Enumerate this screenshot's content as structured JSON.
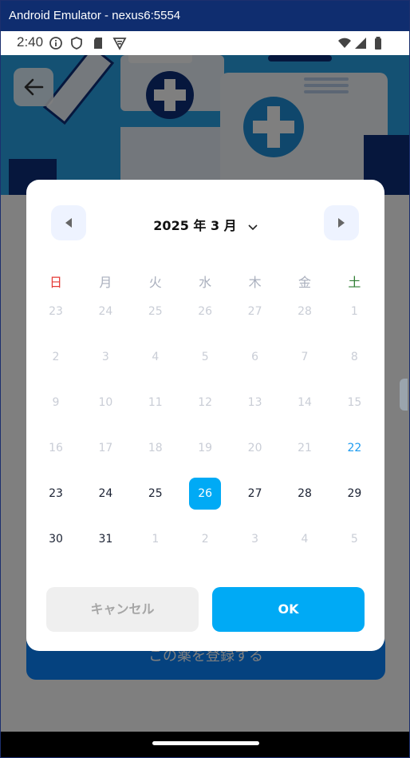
{
  "window": {
    "title": "Android Emulator - nexus6:5554"
  },
  "statusbar": {
    "time": "2:40",
    "icons": [
      "info-icon",
      "shield-icon",
      "sd-card-icon",
      "vpn-icon",
      "wifi-icon",
      "signal-icon",
      "battery-icon"
    ]
  },
  "app": {
    "back_icon": "arrow-left-icon",
    "register_label": "この薬を登録する"
  },
  "dialog": {
    "month_title": "2025 年 3 月",
    "prev_icon": "triangle-left-icon",
    "next_icon": "triangle-right-icon",
    "weekdays": [
      "日",
      "月",
      "火",
      "水",
      "木",
      "金",
      "土"
    ],
    "weeks": [
      [
        "23",
        "24",
        "25",
        "26",
        "27",
        "28",
        "1"
      ],
      [
        "2",
        "3",
        "4",
        "5",
        "6",
        "7",
        "8"
      ],
      [
        "9",
        "10",
        "11",
        "12",
        "13",
        "14",
        "15"
      ],
      [
        "16",
        "17",
        "18",
        "19",
        "20",
        "21",
        "22"
      ],
      [
        "23",
        "24",
        "25",
        "26",
        "27",
        "28",
        "29"
      ],
      [
        "30",
        "31",
        "1",
        "2",
        "3",
        "4",
        "5"
      ]
    ],
    "selected_day": "26",
    "cancel_label": "キャンセル",
    "ok_label": "OK"
  },
  "colors": {
    "accent": "#00aaf5",
    "sunday": "#e53935",
    "saturday": "#2e7d32",
    "weekday": "#a9afbd"
  }
}
